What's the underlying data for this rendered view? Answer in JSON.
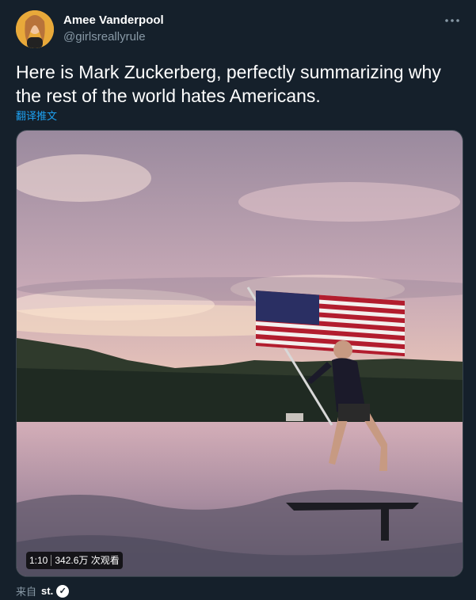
{
  "author": {
    "name": "Amee Vanderpool",
    "handle": "@girlsreallyrule"
  },
  "tweet": {
    "text": "Here is Mark Zuckerberg, perfectly summarizing why the rest of the world hates Americans.",
    "translate_label": "翻译推文"
  },
  "video": {
    "duration": "1:10",
    "views": "342.6万 次观看"
  },
  "source": {
    "prefix": "来自",
    "app": "st."
  },
  "icons": {
    "more": "more-icon",
    "verified": "verified-badge-icon"
  },
  "colors": {
    "background": "#15202b",
    "secondary_text": "#8899a6",
    "link": "#1da1f2"
  }
}
